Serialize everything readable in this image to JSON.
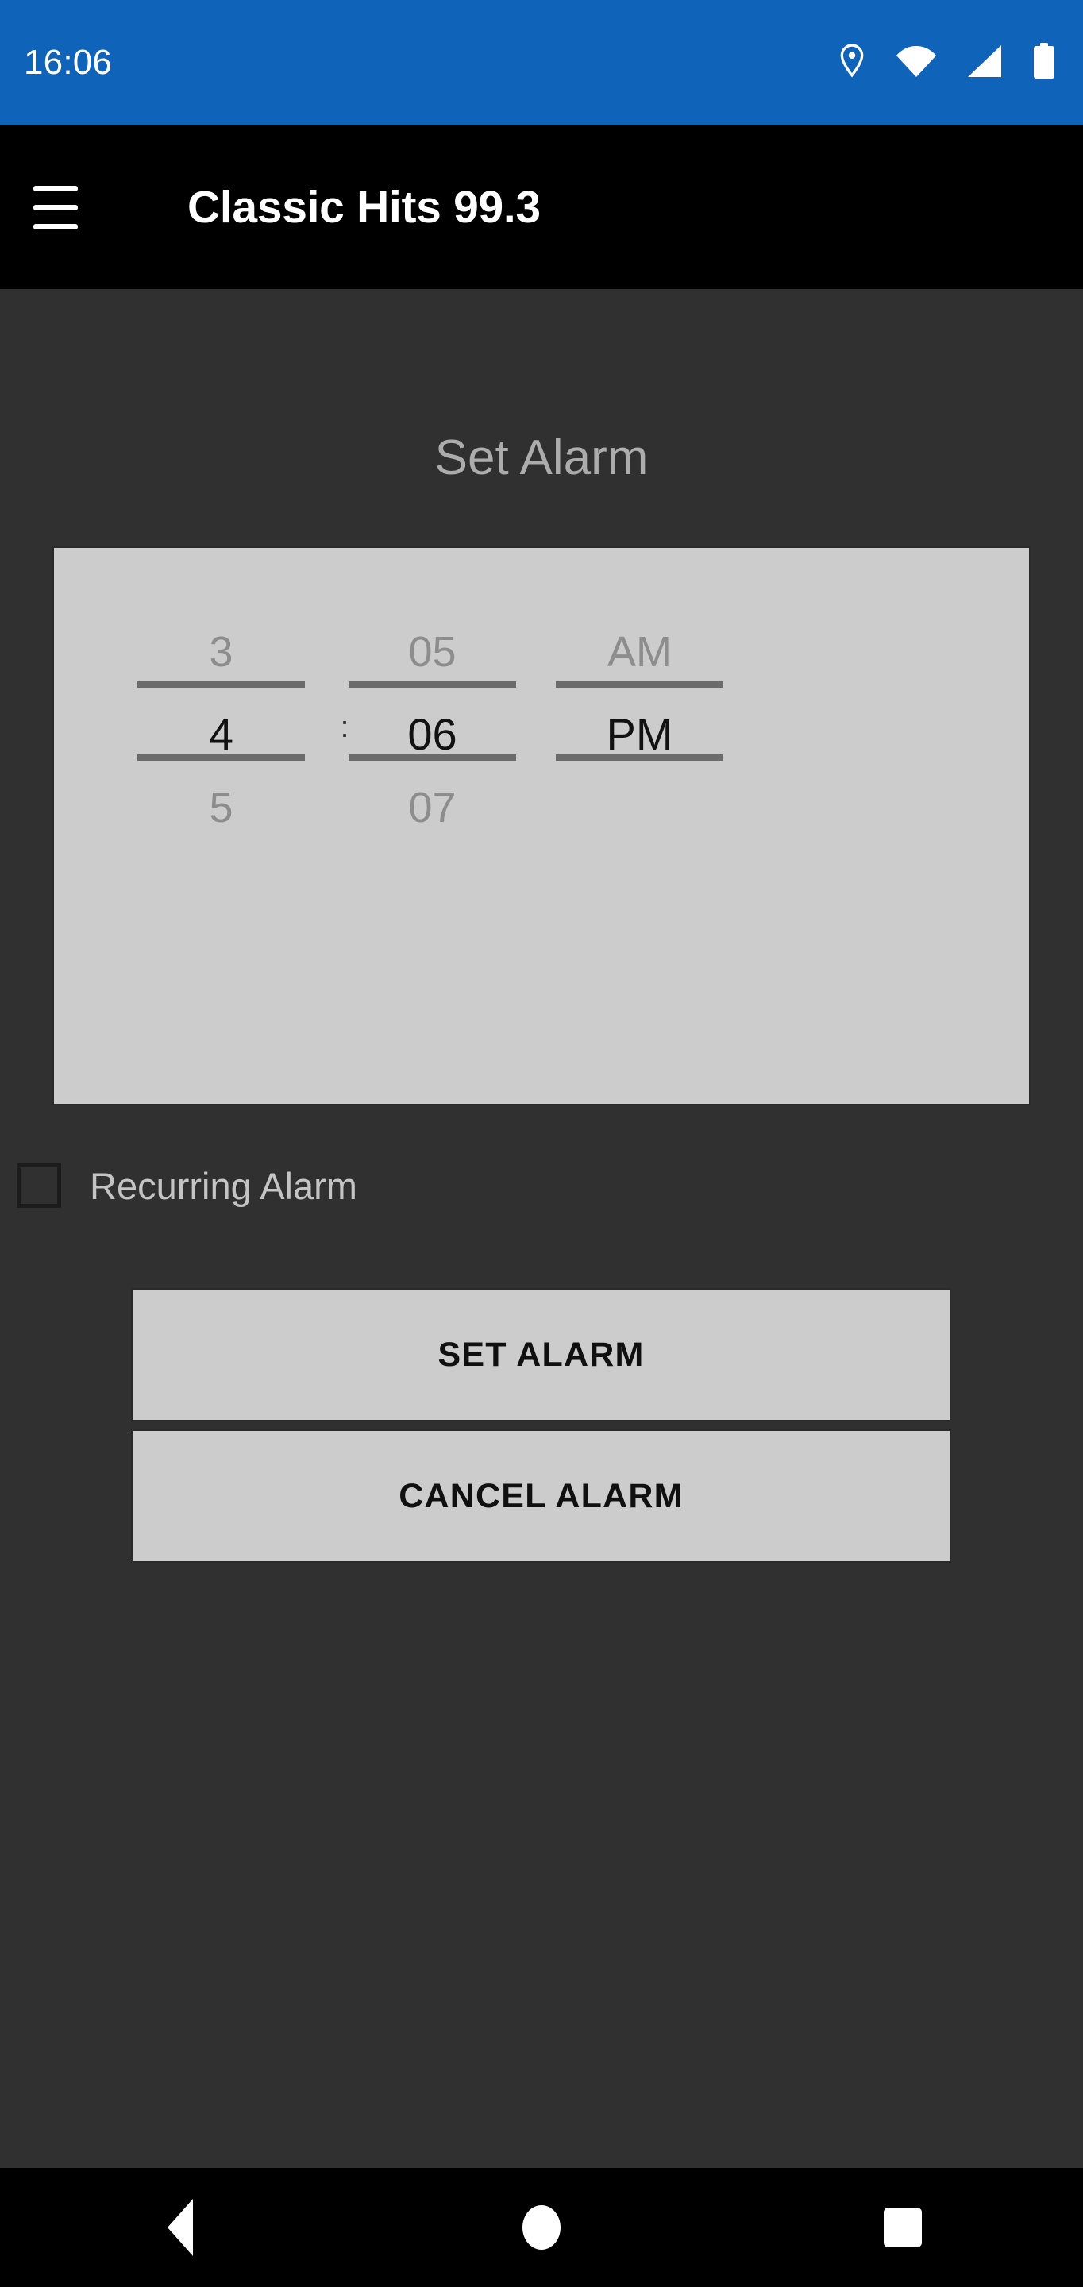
{
  "status_bar": {
    "clock": "16:06",
    "background_color": "#0f63b8",
    "icons": [
      {
        "name": "location-icon",
        "label": "Location"
      },
      {
        "name": "wifi-icon",
        "label": "Wi-Fi"
      },
      {
        "name": "cellular-signal-icon",
        "label": "Cellular signal"
      },
      {
        "name": "battery-icon",
        "label": "Battery"
      }
    ]
  },
  "app_bar": {
    "menu_icon": "hamburger-menu-icon",
    "title": "Classic Hits 99.3",
    "background_color": "#000000"
  },
  "main": {
    "page_title": "Set Alarm",
    "background_color": "#303030",
    "time_picker": {
      "background_color": "#cccccc",
      "separator": ":",
      "columns": [
        {
          "name": "hour",
          "previous": "3",
          "selected": "4",
          "next": "5"
        },
        {
          "name": "minute",
          "previous": "05",
          "selected": "06",
          "next": "07"
        },
        {
          "name": "meridiem",
          "previous": "AM",
          "selected": "PM",
          "next": ""
        }
      ]
    },
    "recurring": {
      "label": "Recurring Alarm",
      "checked": "false"
    },
    "buttons": {
      "set_alarm": "SET ALARM",
      "cancel_alarm": "CANCEL ALARM",
      "background_color": "#cccccc"
    }
  },
  "nav_bar": {
    "background_color": "#000000",
    "buttons": [
      {
        "name": "nav-back-button",
        "label": "Back"
      },
      {
        "name": "nav-home-button",
        "label": "Home"
      },
      {
        "name": "nav-recents-button",
        "label": "Recents"
      }
    ]
  }
}
